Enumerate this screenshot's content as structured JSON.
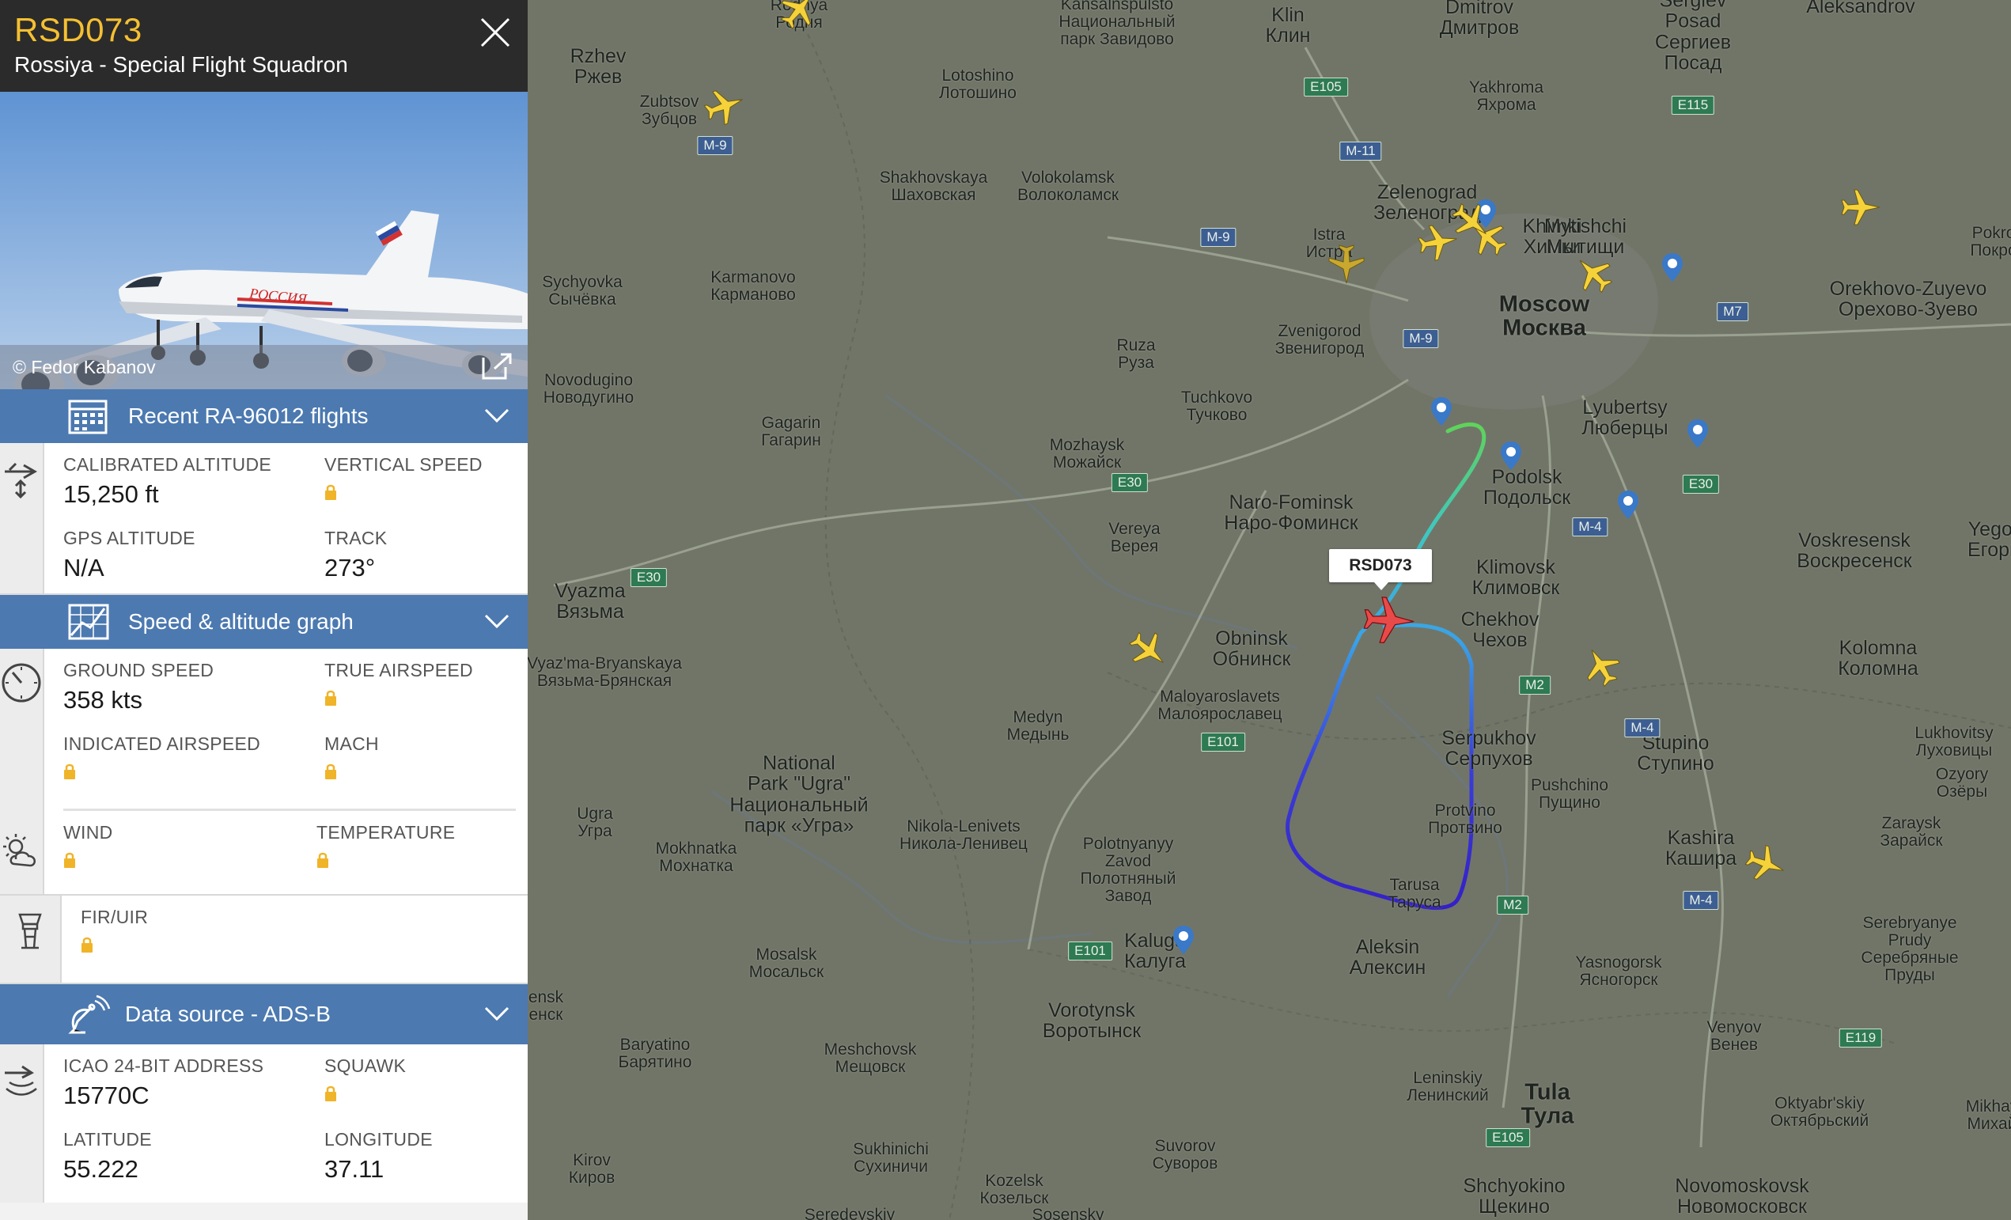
{
  "flight": {
    "callsign": "RSD073",
    "airline": "Rossiya - Special Flight Squadron",
    "photo_credit": "© Fedor Kabanov",
    "aircraft_livery": "РОССИЯ",
    "aircraft_reg": "RA-96012"
  },
  "sections": {
    "recent": "Recent RA-96012 flights",
    "graph": "Speed & altitude graph",
    "source": "Data source - ADS-B"
  },
  "altitude": {
    "cal_alt_label": "CALIBRATED ALTITUDE",
    "cal_alt": "15,250 ft",
    "vs_label": "VERTICAL SPEED",
    "gps_label": "GPS ALTITUDE",
    "gps": "N/A",
    "track_label": "TRACK",
    "track": "273°"
  },
  "speed": {
    "gs_label": "GROUND SPEED",
    "gs": "358 kts",
    "tas_label": "TRUE AIRSPEED",
    "ias_label": "INDICATED AIRSPEED",
    "mach_label": "MACH"
  },
  "weather": {
    "wind_label": "WIND",
    "temp_label": "TEMPERATURE"
  },
  "fir": {
    "label": "FIR/UIR"
  },
  "adsb": {
    "icao_label": "ICAO 24-BIT ADDRESS",
    "icao": "15770C",
    "squawk_label": "SQUAWK",
    "lat_label": "LATITUDE",
    "lat": "55.222",
    "lon_label": "LONGITUDE",
    "lon": "37.11"
  },
  "map": {
    "flight_label": "RSD073",
    "cities": [
      {
        "t": "Rodnya\nРодня",
        "s": "s"
      },
      {
        "t": "Kansalnspulsto\nНациональный\nпарк Завидово",
        "s": "s"
      },
      {
        "t": "Klin\nКлин",
        "s": "m"
      },
      {
        "t": "Dmitrov\nДмитров",
        "s": "m"
      },
      {
        "t": "Sergiev\nPosad\nСергиев\nПосад",
        "s": "m"
      },
      {
        "t": "Aleksandrov",
        "s": "m"
      },
      {
        "t": "Rzhev\nРжев",
        "s": "m"
      },
      {
        "t": "Zubtsov\nЗубцов",
        "s": "s"
      },
      {
        "t": "Lotoshino\nЛотошино",
        "s": "s"
      },
      {
        "t": "Yakhroma\nЯхрома",
        "s": "s"
      },
      {
        "t": "Shakhovskaya\nШаховская",
        "s": "s"
      },
      {
        "t": "Volokolamsk\nВолоколамск",
        "s": "s"
      },
      {
        "t": "Zelenograd\nЗеленоград",
        "s": "m"
      },
      {
        "t": "Khimki\nХимки",
        "s": "m"
      },
      {
        "t": "Mytishchi\nМытищи",
        "s": "m"
      },
      {
        "t": "Istra\nИстра",
        "s": "s"
      },
      {
        "t": "Pokro\nПокро",
        "s": "s"
      },
      {
        "t": "Orekhovo-Zuyevo\nОрехово-Зуево",
        "s": "m"
      },
      {
        "t": "Sychyovka\nСычёвка",
        "s": "s"
      },
      {
        "t": "Karmanovo\nКарманово",
        "s": "s"
      },
      {
        "t": "Moscow\nМосква",
        "s": "l"
      },
      {
        "t": "Zvenigorod\nЗвенигород",
        "s": "s"
      },
      {
        "t": "Ruza\nРуза",
        "s": "s"
      },
      {
        "t": "Novodugino\nНоводугино",
        "s": "s"
      },
      {
        "t": "Tuchkovo\nТучково",
        "s": "s"
      },
      {
        "t": "Lyubertsy\nЛюберцы",
        "s": "m"
      },
      {
        "t": "Gagarin\nГагарин",
        "s": "s"
      },
      {
        "t": "Mozhaysk\nМожайск",
        "s": "s"
      },
      {
        "t": "Podolsk\nПодольск",
        "s": "m"
      },
      {
        "t": "Naro-Fominsk\nНаро-Фоминск",
        "s": "m"
      },
      {
        "t": "Vereya\nВерея",
        "s": "s"
      },
      {
        "t": "Voskresensk\nВоскресенск",
        "s": "m"
      },
      {
        "t": "Yegor\nЕгорь",
        "s": "m"
      },
      {
        "t": "Klimovsk\nКлимовск",
        "s": "m"
      },
      {
        "t": "Vyazma\nВязьма",
        "s": "m"
      },
      {
        "t": "Chekhov\nЧехов",
        "s": "m"
      },
      {
        "t": "Obninsk\nОбнинск",
        "s": "m"
      },
      {
        "t": "Kolomna\nКоломна",
        "s": "m"
      },
      {
        "t": "Vyaz'ma-Bryanskaya\nВязьма-Брянская",
        "s": "s"
      },
      {
        "t": "Maloyaroslavets\nМалоярославец",
        "s": "s"
      },
      {
        "t": "Medyn\nМедынь",
        "s": "s"
      },
      {
        "t": "Serpukhov\nСерпухов",
        "s": "m"
      },
      {
        "t": "Stupino\nСтупино",
        "s": "m"
      },
      {
        "t": "Lukhovitsy\nЛуховицы",
        "s": "s"
      },
      {
        "t": "National\nPark \"Ugra\"\nНациональный\nпарк «Угра»",
        "s": "m"
      },
      {
        "t": "Pushchino\nПущино",
        "s": "s"
      },
      {
        "t": "Ozyory\nОзёры",
        "s": "s"
      },
      {
        "t": "Protvino\nПротвино",
        "s": "s"
      },
      {
        "t": "Ugra\nУгра",
        "s": "s"
      },
      {
        "t": "Nikola-Lenivets\nНикола-Ленивец",
        "s": "s"
      },
      {
        "t": "Polotnyanyy\nZavod\nПолотняный\nЗавод",
        "s": "s"
      },
      {
        "t": "Kashira\nКашира",
        "s": "m"
      },
      {
        "t": "Zaraysk\nЗарайск",
        "s": "s"
      },
      {
        "t": "Mokhnatka\nМохнатка",
        "s": "s"
      },
      {
        "t": "Tarusa\nТаруса",
        "s": "s"
      },
      {
        "t": "Kaluga\nКалуга",
        "s": "m"
      },
      {
        "t": "Aleksin\nАлексин",
        "s": "m"
      },
      {
        "t": "Yasnogorsk\nЯсногорск",
        "s": "s"
      },
      {
        "t": "Serebryanye\nPrudy\nСеребряные\nПруды",
        "s": "s"
      },
      {
        "t": "Mosalsk\nМосальск",
        "s": "s"
      },
      {
        "t": "ensk\nенск",
        "s": "s"
      },
      {
        "t": "Vorotynsk\nВоротынск",
        "s": "m"
      },
      {
        "t": "Baryatino\nБарятино",
        "s": "s"
      },
      {
        "t": "Meshchovsk\nМещовск",
        "s": "s"
      },
      {
        "t": "Venyov\nВенев",
        "s": "s"
      },
      {
        "t": "Leninskiy\nЛенинский",
        "s": "s"
      },
      {
        "t": "Tula\nТула",
        "s": "l"
      },
      {
        "t": "Oktyabr'skiy\nОктябрьский",
        "s": "s"
      },
      {
        "t": "Mikhay\nМихай",
        "s": "s"
      },
      {
        "t": "Sukhinichi\nСухиничи",
        "s": "s"
      },
      {
        "t": "Suvorov\nСуворов",
        "s": "s"
      },
      {
        "t": "Kirov\nКиров",
        "s": "s"
      },
      {
        "t": "Kozelsk\nКозельск",
        "s": "s"
      },
      {
        "t": "Shchyokino\nЩекино",
        "s": "m"
      },
      {
        "t": "Novomoskovsk\nНовомосковск",
        "s": "m"
      },
      {
        "t": "Seredeyskiy",
        "s": "s"
      },
      {
        "t": "Sosensky",
        "s": "s"
      }
    ],
    "roads": [
      "E105",
      "M-9",
      "M-11",
      "E115",
      "M-9",
      "M-9",
      "M7",
      "E30",
      "M-4",
      "E30",
      "E30",
      "M2",
      "M-4",
      "E101",
      "E101",
      "M2",
      "M-4",
      "E119",
      "E105"
    ],
    "colors": {
      "panel_header": "#2b2b2b",
      "callsign": "#f5c031",
      "section": "#4c79b0",
      "lock": "#f0b429"
    }
  }
}
